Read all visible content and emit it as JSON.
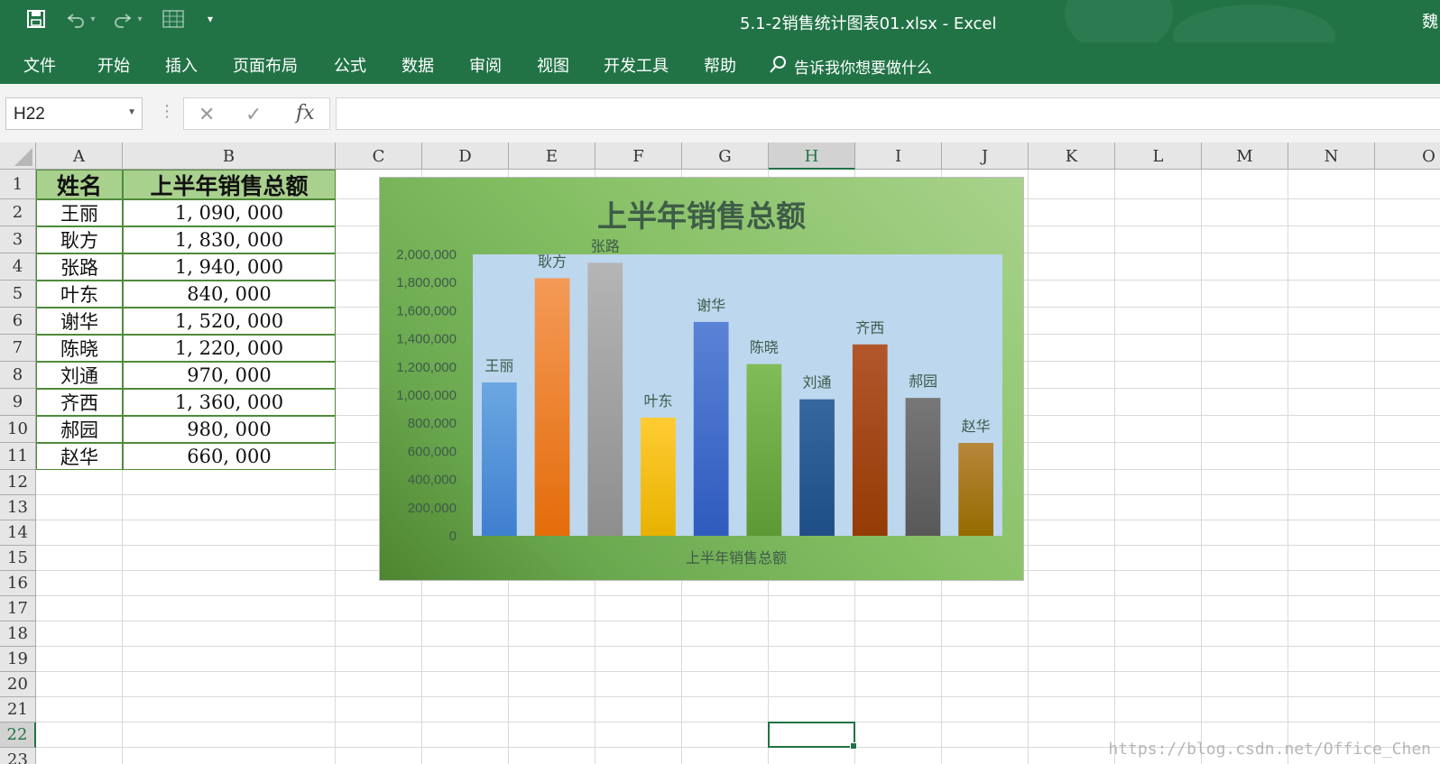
{
  "titlebar": {
    "doc_title": "5.1-2销售统计图表01.xlsx  -  Excel",
    "user_initial": "魏"
  },
  "ribbon": {
    "tabs": [
      "文件",
      "开始",
      "插入",
      "页面布局",
      "公式",
      "数据",
      "审阅",
      "视图",
      "开发工具",
      "帮助"
    ],
    "tell_me": "告诉我你想要做什么"
  },
  "formula_bar": {
    "name_box": "H22",
    "formula": ""
  },
  "sheet": {
    "columns": [
      "A",
      "B",
      "C",
      "D",
      "E",
      "F",
      "G",
      "H",
      "I",
      "J",
      "K",
      "L",
      "M",
      "N",
      "O"
    ],
    "rows": [
      "1",
      "2",
      "3",
      "4",
      "5",
      "6",
      "7",
      "8",
      "9",
      "10",
      "11",
      "12",
      "13",
      "14",
      "15",
      "16",
      "17",
      "18",
      "19",
      "20",
      "21",
      "22",
      "23"
    ],
    "active_column": "H",
    "active_row": "22",
    "table_header": [
      "姓名",
      "上半年销售总额"
    ],
    "table_rows": [
      [
        "王丽",
        "1, 090, 000"
      ],
      [
        "耿方",
        "1, 830, 000"
      ],
      [
        "张路",
        "1, 940, 000"
      ],
      [
        "叶东",
        "840, 000"
      ],
      [
        "谢华",
        "1, 520, 000"
      ],
      [
        "陈晓",
        "1, 220, 000"
      ],
      [
        "刘通",
        "970, 000"
      ],
      [
        "齐西",
        "1, 360, 000"
      ],
      [
        "郝园",
        "980, 000"
      ],
      [
        "赵华",
        "660, 000"
      ]
    ]
  },
  "chart_data": {
    "type": "bar",
    "title": "上半年销售总额",
    "xlabel": "上半年销售总额",
    "ylabel": "",
    "categories": [
      "王丽",
      "耿方",
      "张路",
      "叶东",
      "谢华",
      "陈晓",
      "刘通",
      "齐西",
      "郝园",
      "赵华"
    ],
    "values": [
      1090000,
      1830000,
      1940000,
      840000,
      1520000,
      1220000,
      970000,
      1360000,
      980000,
      660000
    ],
    "ylim": [
      0,
      2000000
    ],
    "y_ticks": [
      "0",
      "200,000",
      "400,000",
      "600,000",
      "800,000",
      "1,000,000",
      "1,200,000",
      "1,400,000",
      "1,600,000",
      "1,800,000",
      "2,000,000"
    ],
    "grid": false,
    "legend": "none",
    "data_labels": "category name above each bar",
    "bar_colors": [
      [
        "#3f7fcf",
        "#6ba7e2"
      ],
      [
        "#e46c0a",
        "#f49a57"
      ],
      [
        "#8e8e8e",
        "#b5b5b5"
      ],
      [
        "#e8b100",
        "#ffcc33"
      ],
      [
        "#2f5bbf",
        "#5a82d6"
      ],
      [
        "#5b9a34",
        "#80bd58"
      ],
      [
        "#1f4e86",
        "#36679e"
      ],
      [
        "#943b05",
        "#b2572b"
      ],
      [
        "#585858",
        "#777777"
      ],
      [
        "#956b00",
        "#b8863a"
      ]
    ],
    "plot_area_color": "#bdd7ee"
  },
  "watermark": "https://blog.csdn.net/Office_Chen"
}
